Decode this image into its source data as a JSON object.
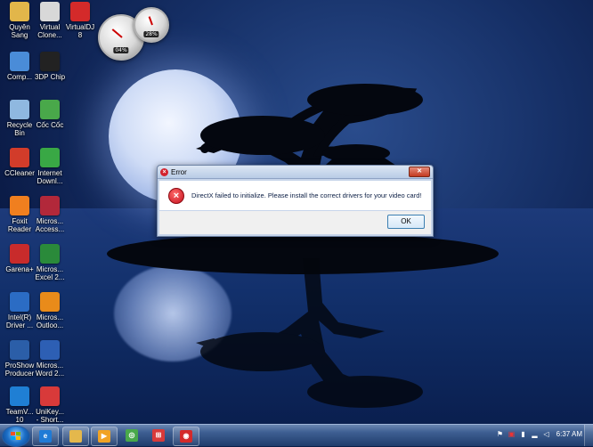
{
  "desktop": {
    "icons": [
      {
        "label": "Quyên\nSang",
        "icon": "folder-user-icon",
        "color": "#e2b64a"
      },
      {
        "label": "Virtual\nClone...",
        "icon": "virtual-clone-icon",
        "color": "#d8d8d8"
      },
      {
        "label": "VirtualDJ\n8",
        "icon": "virtualdj-icon",
        "color": "#d42a2a"
      },
      {
        "label": "Comp...",
        "icon": "computer-icon",
        "color": "#4a8cd8"
      },
      {
        "label": "3DP Chip",
        "icon": "chip-icon",
        "color": "#222222"
      },
      {
        "label": "Recycle\nBin",
        "icon": "recycle-bin-icon",
        "color": "#8fb8e0"
      },
      {
        "label": "Cốc Cốc",
        "icon": "coccoc-icon",
        "color": "#49a84a"
      },
      {
        "label": "CCleaner",
        "icon": "ccleaner-icon",
        "color": "#d23c2a"
      },
      {
        "label": "Internet\nDownl...",
        "icon": "download-manager-icon",
        "color": "#39a845"
      },
      {
        "label": "Foxit\nReader",
        "icon": "foxit-reader-icon",
        "color": "#f07f1f"
      },
      {
        "label": "Micros...\nAccess...",
        "icon": "ms-access-icon",
        "color": "#b2283a"
      },
      {
        "label": "Garena+",
        "icon": "garena-icon",
        "color": "#c82b2b"
      },
      {
        "label": "Micros...\nExcel 2...",
        "icon": "ms-excel-icon",
        "color": "#2a8a3a"
      },
      {
        "label": "Intel(R)\nDriver ...",
        "icon": "intel-driver-icon",
        "color": "#2b6cc4"
      },
      {
        "label": "Micros...\nOutloo...",
        "icon": "ms-outlook-icon",
        "color": "#e98b1a"
      },
      {
        "label": "ProShow\nProducer",
        "icon": "proshow-icon",
        "color": "#2b5ea8"
      },
      {
        "label": "Micros...\nWord 2...",
        "icon": "ms-word-icon",
        "color": "#2d5fb4"
      },
      {
        "label": "TeamV...\n10",
        "icon": "teamviewer-icon",
        "color": "#1f7fd4"
      },
      {
        "label": "UniKey...\n- Short...",
        "icon": "unikey-icon",
        "color": "#d83a3a"
      }
    ],
    "gadgets": [
      {
        "name": "cpu-meter-gadget",
        "value": "04%"
      },
      {
        "name": "ram-meter-gadget",
        "value": "28%"
      }
    ]
  },
  "dialog": {
    "title": "Error",
    "message": "DirectX failed to initialize. Please install the correct drivers for your video card!",
    "ok_label": "OK",
    "close_glyph": "✕"
  },
  "taskbar": {
    "items": [
      {
        "name": "internet-explorer",
        "icon": "ie-icon",
        "color": "#1f7bd6",
        "glyph": "e"
      },
      {
        "name": "file-explorer",
        "icon": "folder-icon",
        "color": "#e4b84c",
        "glyph": ""
      },
      {
        "name": "media-player",
        "icon": "media-player-icon",
        "color": "#f1a324",
        "glyph": "▶"
      },
      {
        "name": "coccoc",
        "icon": "coccoc-icon",
        "color": "#49a84a",
        "glyph": "◎"
      },
      {
        "name": "unikey",
        "icon": "unikey-icon",
        "color": "#d83a3a",
        "glyph": "⊞"
      },
      {
        "name": "virtualdj",
        "icon": "virtualdj-icon",
        "color": "#d42a2a",
        "glyph": "◉"
      }
    ],
    "clock": "6:37 AM"
  }
}
